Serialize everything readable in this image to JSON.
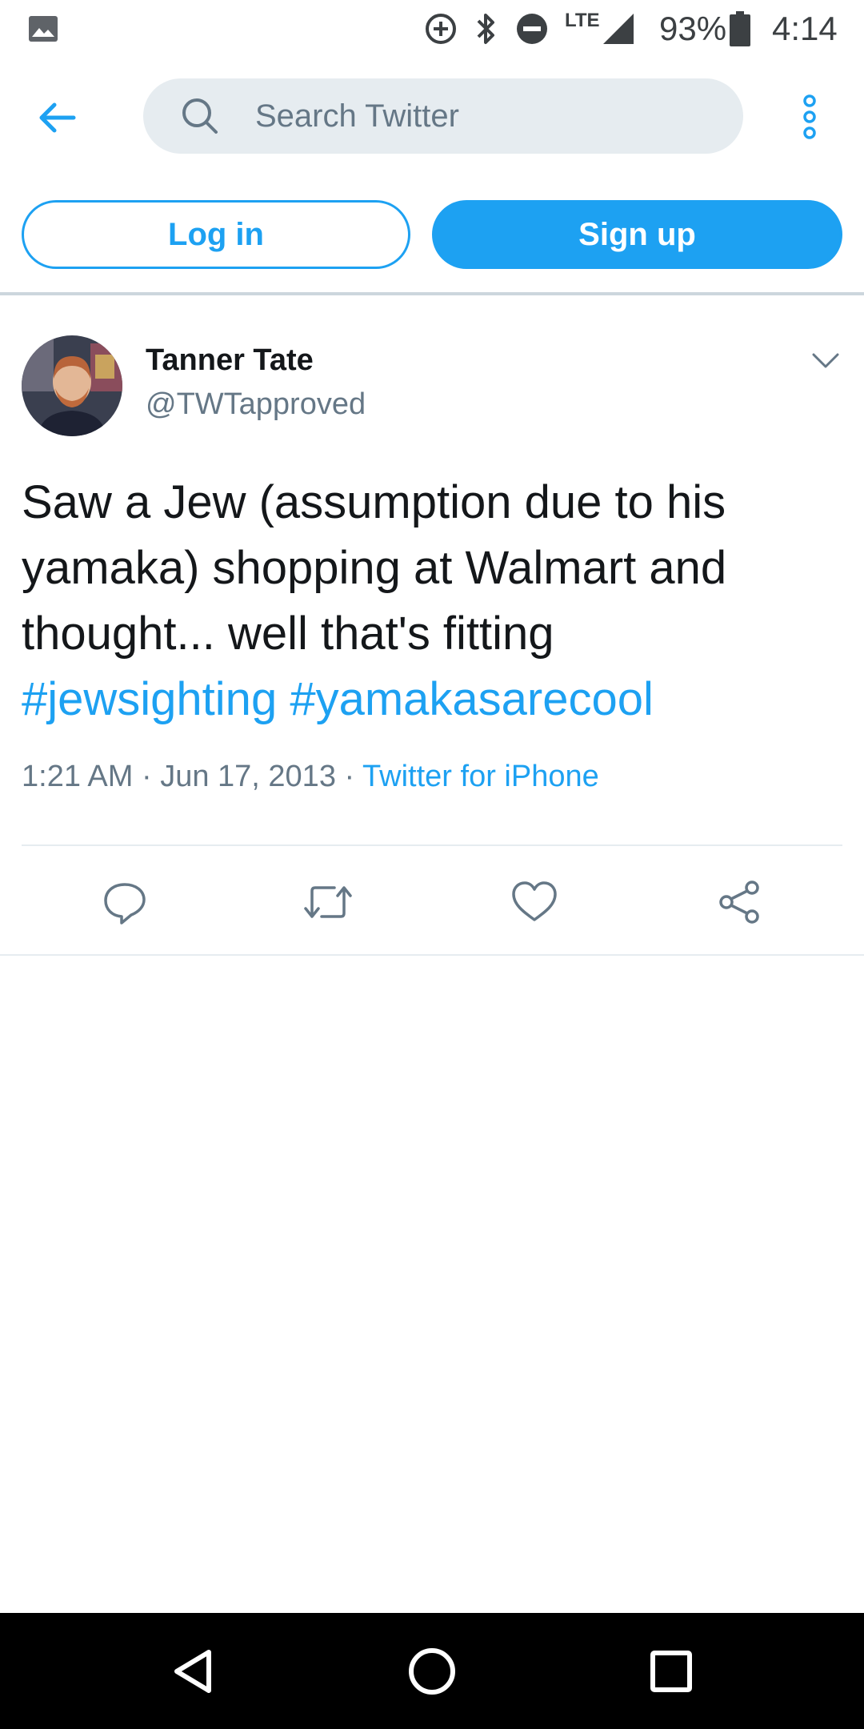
{
  "status_bar": {
    "battery": "93%",
    "time": "4:14",
    "network": "LTE",
    "icons": [
      "image-icon",
      "data-saver-icon",
      "bluetooth-icon",
      "do-not-disturb-icon",
      "signal-icon",
      "battery-icon"
    ]
  },
  "header": {
    "search_placeholder": "Search Twitter",
    "icons": [
      "back-arrow-icon",
      "search-icon",
      "more-vertical-icon"
    ]
  },
  "auth": {
    "login_label": "Log in",
    "signup_label": "Sign up"
  },
  "tweet": {
    "author_name": "Tanner Tate",
    "author_handle": "@TWTapproved",
    "text": "Saw a Jew (assumption due to his yamaka) shopping at Walmart and thought... well that's fitting",
    "hashtags": [
      "#jewsighting",
      "#yamakasarecool"
    ],
    "time": "1:21 AM",
    "separator": "·",
    "date": "Jun 17, 2013",
    "source": "Twitter for iPhone",
    "action_icons": [
      "reply-icon",
      "retweet-icon",
      "like-icon",
      "share-icon"
    ]
  },
  "colors": {
    "accent": "#1da1f2",
    "text_primary": "#14171a",
    "text_secondary": "#657786",
    "search_bg": "#e6ecf0",
    "divider": "#ccd6dd"
  },
  "nav_bar": {
    "icons": [
      "back-triangle-icon",
      "home-circle-icon",
      "recents-square-icon"
    ]
  }
}
